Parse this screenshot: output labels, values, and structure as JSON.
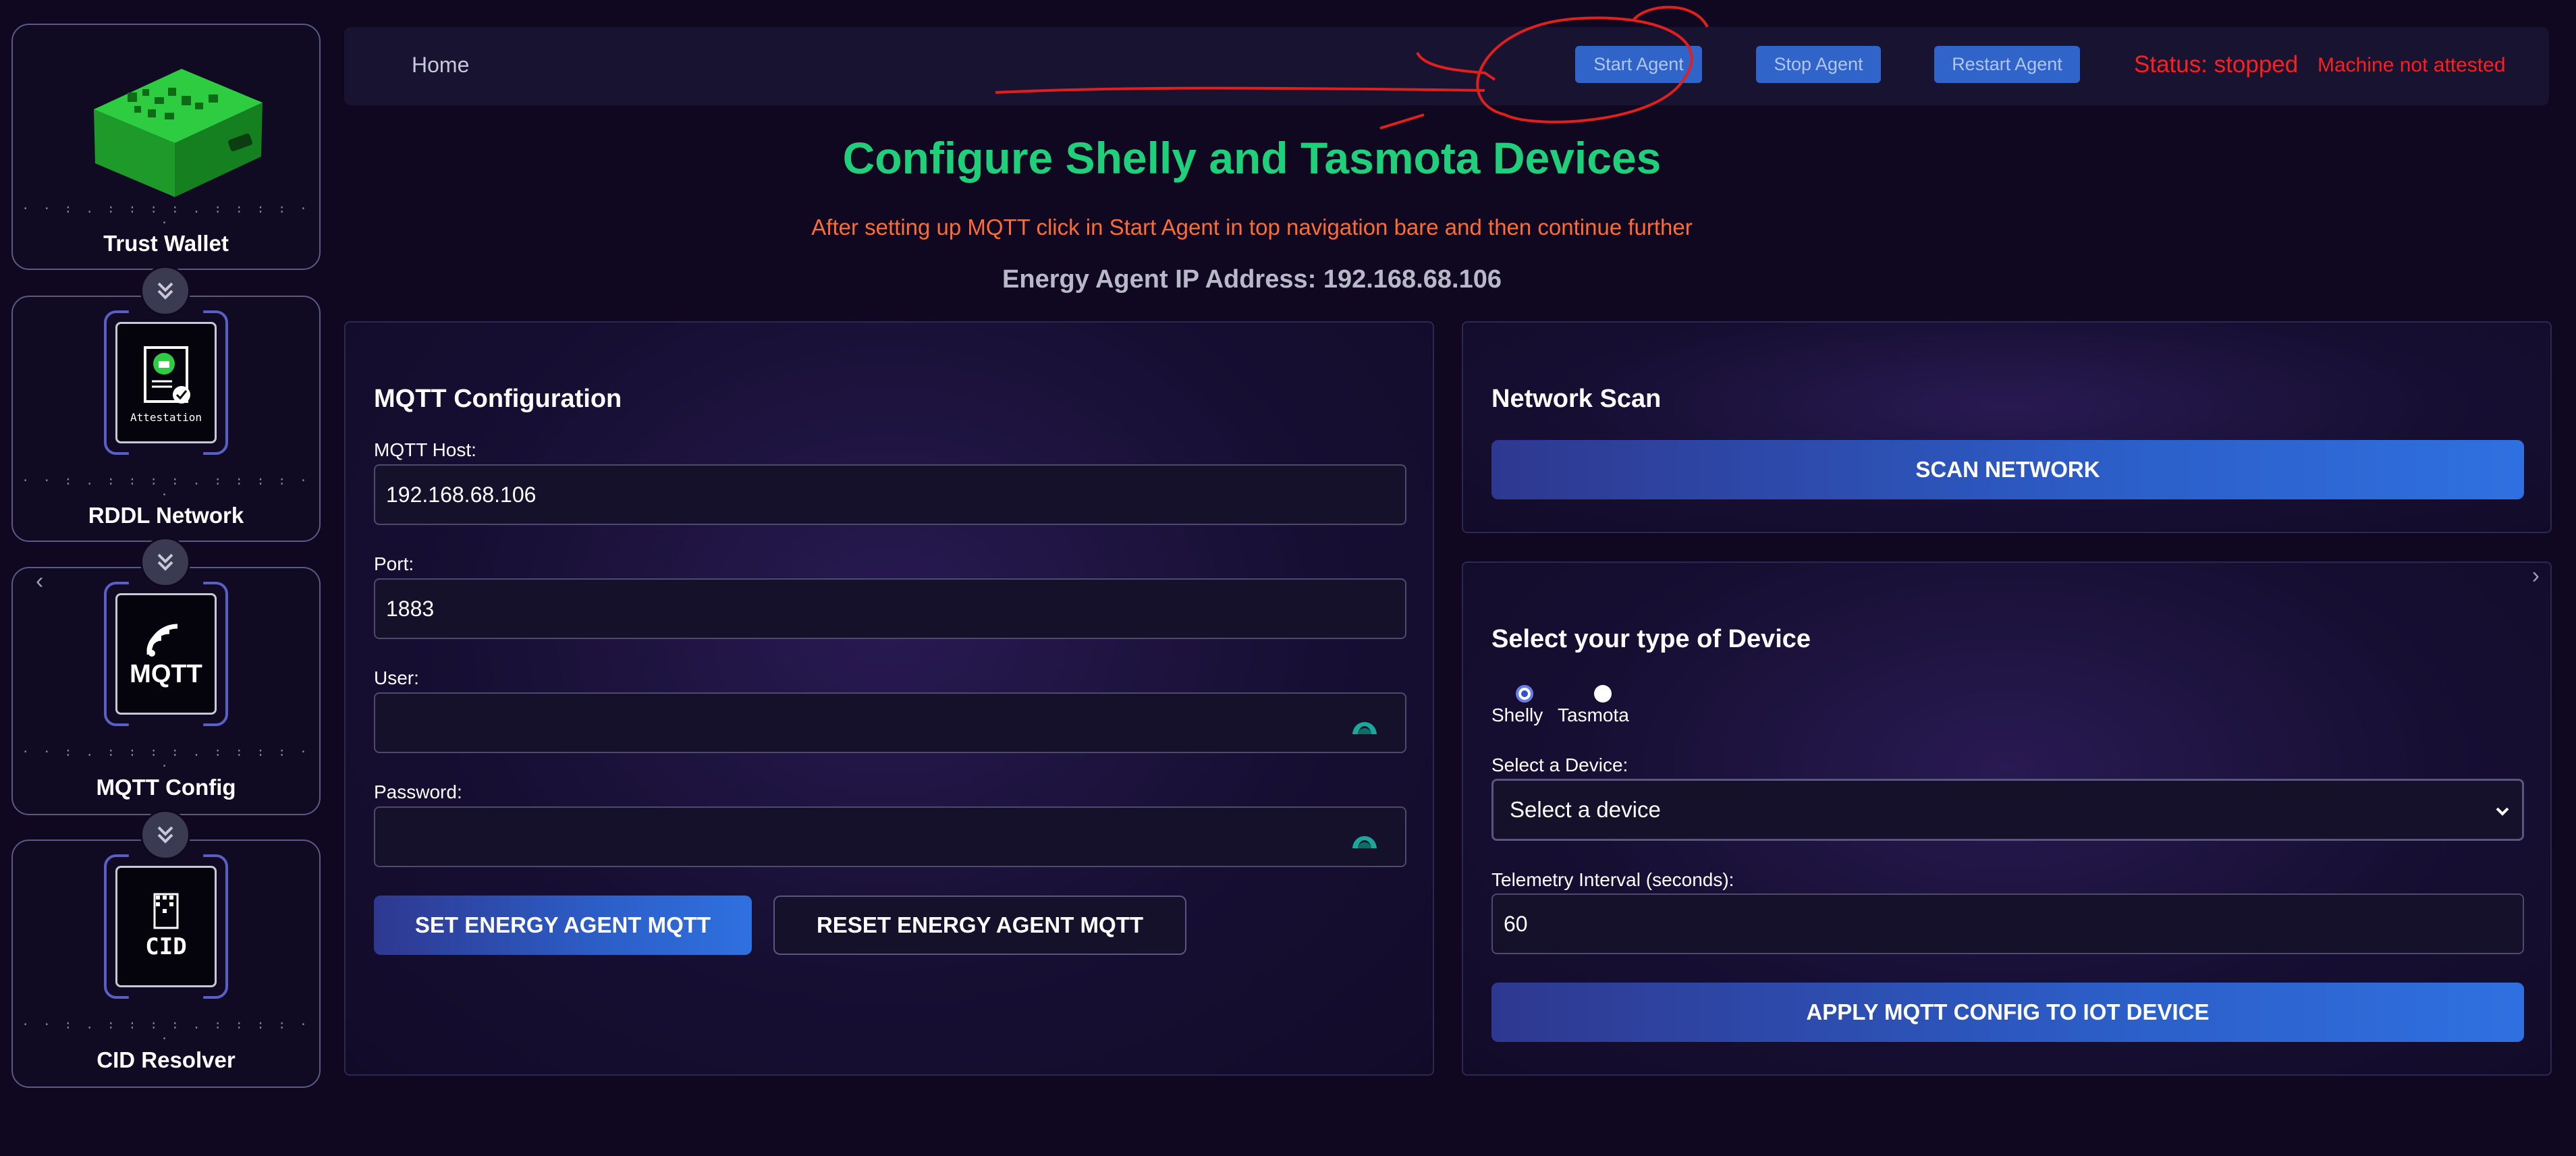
{
  "sidebar": {
    "cards": [
      {
        "label": "Trust Wallet"
      },
      {
        "label": "RDDL Network",
        "icon_text": "Attestation"
      },
      {
        "label": "MQTT Config",
        "icon_text": "MQTT"
      },
      {
        "label": "CID Resolver",
        "icon_text": "CID"
      }
    ],
    "dots": "· · : . : : : : . : : : : · ·"
  },
  "nav": {
    "home": "Home",
    "start": "Start Agent",
    "stop": "Stop Agent",
    "restart": "Restart Agent",
    "status": "Status: stopped",
    "attestation": "Machine not attested"
  },
  "header": {
    "title": "Configure Shelly and Tasmota Devices",
    "subtitle": "After setting up MQTT click in Start Agent in top navigation bare and then continue further",
    "ip": "Energy Agent IP Address: 192.168.68.106"
  },
  "mqtt": {
    "title": "MQTT Configuration",
    "host_label": "MQTT Host:",
    "host_value": "192.168.68.106",
    "port_label": "Port:",
    "port_value": "1883",
    "user_label": "User:",
    "user_value": "",
    "password_label": "Password:",
    "password_value": "",
    "set_button": "SET ENERGY AGENT MQTT",
    "reset_button": "RESET ENERGY AGENT MQTT"
  },
  "scan": {
    "title": "Network Scan",
    "button": "SCAN NETWORK"
  },
  "device": {
    "title": "Select your type of Device",
    "types": [
      "Shelly",
      "Tasmota"
    ],
    "selected_type": "Shelly",
    "select_label": "Select a Device:",
    "select_value": "Select a device",
    "interval_label": "Telemetry Interval (seconds):",
    "interval_value": "60",
    "apply_button": "APPLY MQTT CONFIG TO IOT DEVICE"
  },
  "colors": {
    "title_green": "#1fcf7a",
    "subtitle_orange": "#ff6b35",
    "status_red": "#ff1e1e",
    "button_blue": "#2c5ec8",
    "annotation_red": "#e0201c"
  }
}
